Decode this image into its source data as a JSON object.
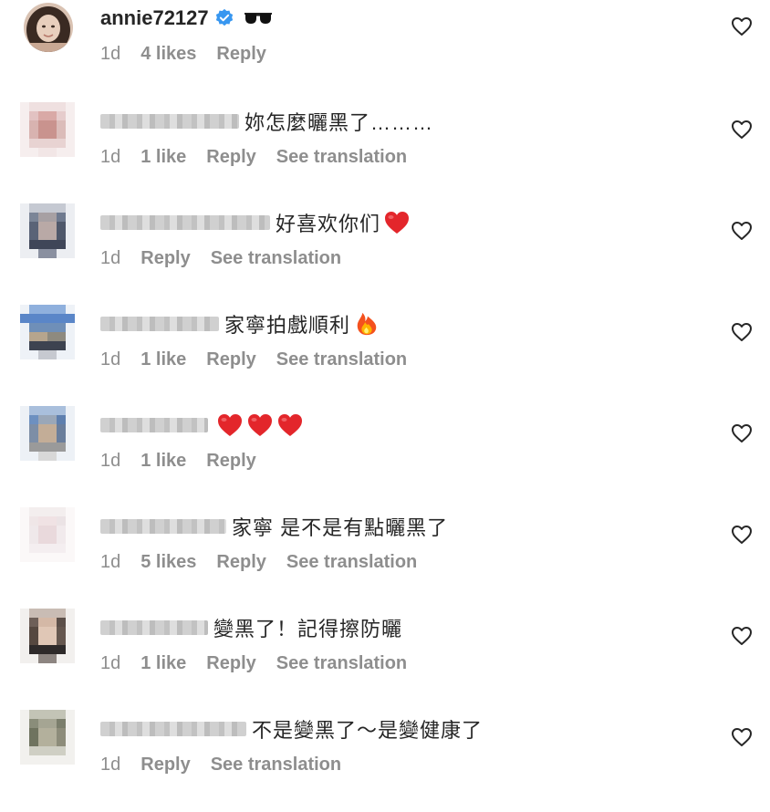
{
  "comments": [
    {
      "username": "annie72127",
      "verified": true,
      "text": "",
      "emoji": "sunglasses",
      "time": "1d",
      "likes": "4 likes",
      "reply": "Reply",
      "translate": ""
    },
    {
      "text": "妳怎麼曬黑了………",
      "time": "1d",
      "likes": "1 like",
      "reply": "Reply",
      "translate": "See translation"
    },
    {
      "text": "好喜欢你们",
      "emoji": "red-heart",
      "time": "1d",
      "likes": "",
      "reply": "Reply",
      "translate": "See translation"
    },
    {
      "text": "家寧拍戲順利",
      "emoji": "fire",
      "time": "1d",
      "likes": "1 like",
      "reply": "Reply",
      "translate": "See translation"
    },
    {
      "text": "",
      "emoji": "three-red-hearts",
      "time": "1d",
      "likes": "1 like",
      "reply": "Reply",
      "translate": ""
    },
    {
      "text": "家寧 是不是有點曬黑了",
      "time": "1d",
      "likes": "5 likes",
      "reply": "Reply",
      "translate": "See translation"
    },
    {
      "text": "變黑了！記得擦防曬",
      "time": "1d",
      "likes": "1 like",
      "reply": "Reply",
      "translate": "See translation"
    },
    {
      "text": "不是變黑了～是變健康了",
      "time": "1d",
      "likes": "",
      "reply": "Reply",
      "translate": "See translation"
    }
  ],
  "icons": {
    "like": "heart-outline-icon",
    "verified": "verified-badge-icon"
  },
  "colors": {
    "meta_text": "#8e8e8e",
    "text": "#262626",
    "verified_blue": "#3897f0"
  }
}
